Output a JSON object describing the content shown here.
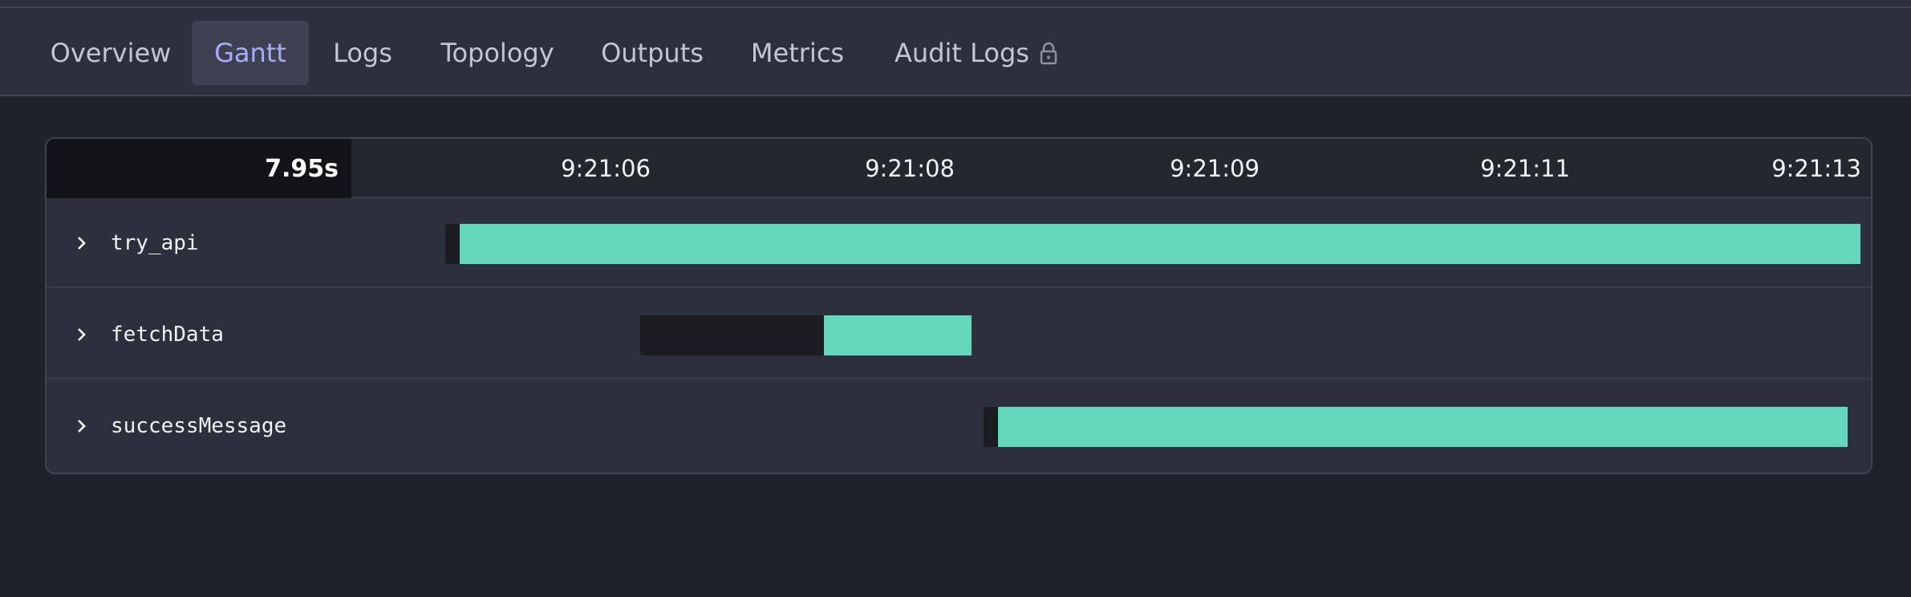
{
  "tabs": [
    {
      "label": "Overview",
      "active": false
    },
    {
      "label": "Gantt",
      "active": true
    },
    {
      "label": "Logs",
      "active": false
    },
    {
      "label": "Topology",
      "active": false
    },
    {
      "label": "Outputs",
      "active": false
    },
    {
      "label": "Metrics",
      "active": false
    },
    {
      "label": "Audit Logs",
      "active": false,
      "icon": "lock-icon"
    }
  ],
  "colors": {
    "accent_tab_text": "#a9adfa",
    "run_bar": "#63d6bc",
    "wait_bar": "#1c1d22"
  },
  "gantt": {
    "total_duration": "7.95s",
    "ticks": [
      "9:21:06",
      "9:21:08",
      "9:21:09",
      "9:21:11",
      "9:21:13"
    ],
    "tasks": [
      {
        "name": "try_api",
        "icon": "chevron-right-icon"
      },
      {
        "name": "fetchData",
        "icon": "chevron-right-icon"
      },
      {
        "name": "successMessage",
        "icon": "chevron-right-icon"
      }
    ]
  }
}
